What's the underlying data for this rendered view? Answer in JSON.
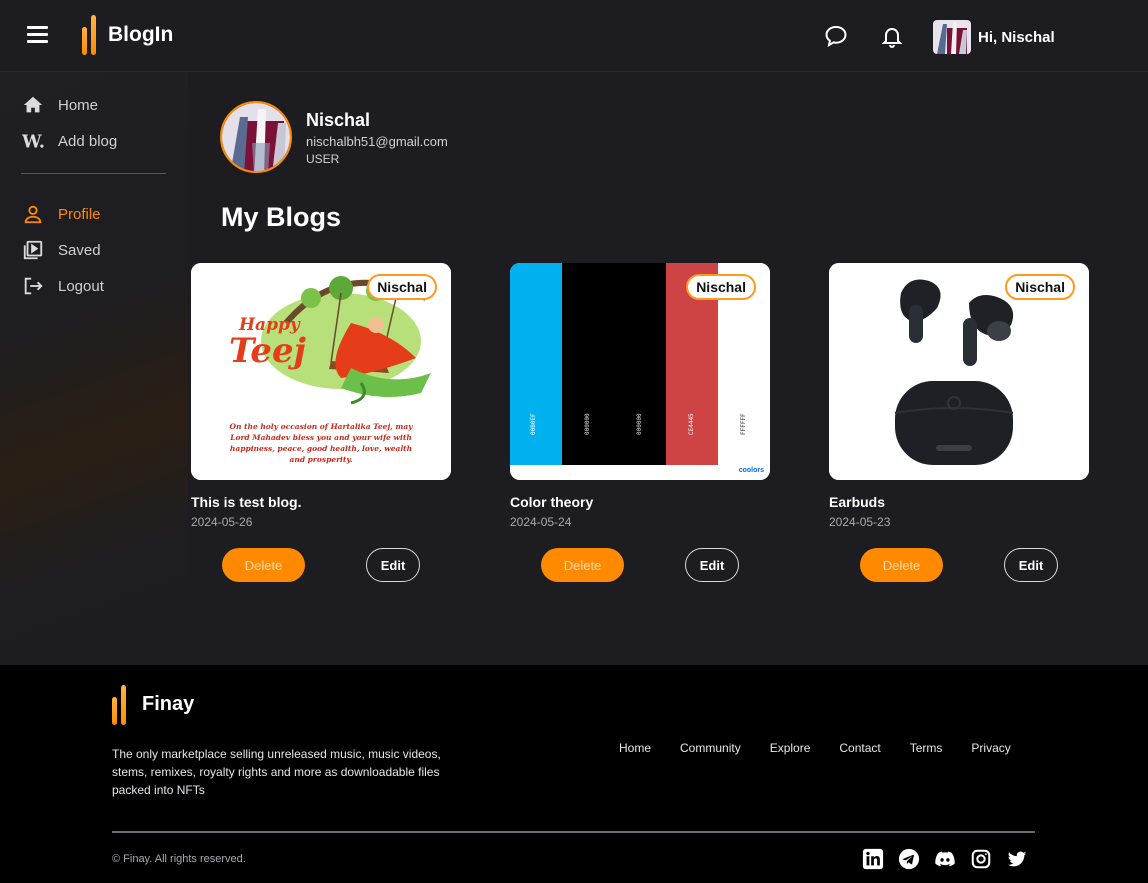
{
  "header": {
    "brand": "BlogIn",
    "greeting": "Hi, Nischal"
  },
  "sidebar": {
    "items": [
      {
        "label": "Home",
        "icon": "home-icon"
      },
      {
        "label": "Add blog",
        "icon": "w-logo-icon"
      },
      {
        "label": "Profile",
        "icon": "person-icon",
        "active": true
      },
      {
        "label": "Saved",
        "icon": "saved-icon"
      },
      {
        "label": "Logout",
        "icon": "logout-icon"
      }
    ]
  },
  "profile": {
    "name": "Nischal",
    "email": "nischalbh51@gmail.com",
    "role": "USER"
  },
  "section_title": "My Blogs",
  "blogs": [
    {
      "title": "This is test blog.",
      "date": "2024-05-26",
      "author": "Nischal",
      "delete_label": "Delete",
      "edit_label": "Edit",
      "image_text": {
        "line1": "Happy",
        "line2": "Teej",
        "message": "On the holy occasion of Hartalika Teej, may Lord Mahadev bless you and your wife with happiness, peace, good health, love, wealth and prosperity."
      }
    },
    {
      "title": "Color theory",
      "date": "2024-05-24",
      "author": "Nischal",
      "delete_label": "Delete",
      "edit_label": "Edit",
      "palette": [
        {
          "hex": "#00B0EF",
          "code": "00B0EF"
        },
        {
          "hex": "#000000",
          "code": "000000"
        },
        {
          "hex": "#000000",
          "code": "000000"
        },
        {
          "hex": "#CE4445",
          "code": "CE4445"
        },
        {
          "hex": "#FFFFFF",
          "code": "FFFFFF"
        }
      ],
      "brand_mark": "coolors"
    },
    {
      "title": "Earbuds",
      "date": "2024-05-23",
      "author": "Nischal",
      "delete_label": "Delete",
      "edit_label": "Edit"
    }
  ],
  "footer": {
    "brand": "Finay",
    "description": "The only marketplace selling unreleased music, music videos, stems, remixes, royalty rights and more as downloadable files packed into NFTs",
    "links": [
      "Home",
      "Community",
      "Explore",
      "Contact",
      "Terms",
      "Privacy"
    ],
    "copyright": "© Finay. All rights reserved.",
    "socials": [
      "linkedin-icon",
      "telegram-icon",
      "discord-icon",
      "instagram-icon",
      "twitter-icon"
    ]
  },
  "colors": {
    "accent": "#FF8A00",
    "background": "#1C1C21",
    "footer": "#000000"
  }
}
